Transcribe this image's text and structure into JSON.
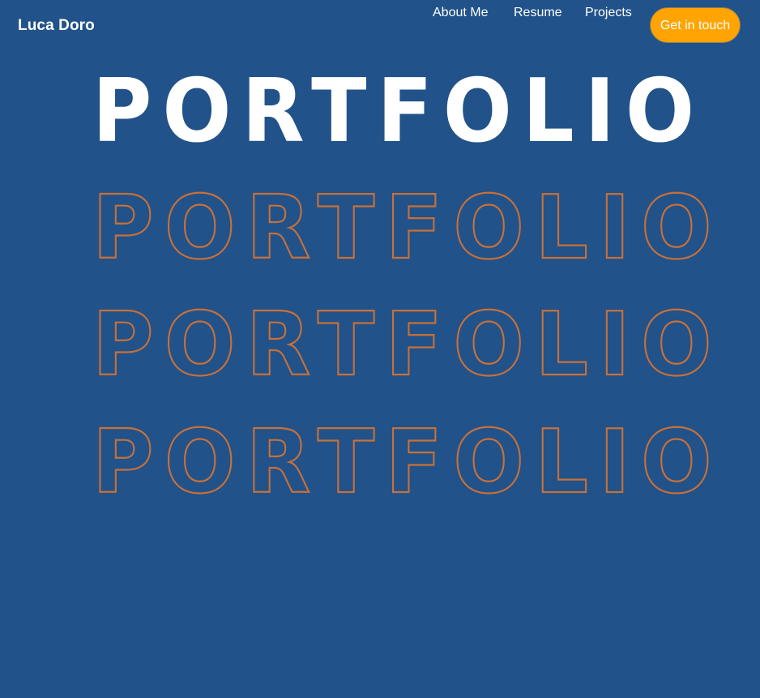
{
  "header": {
    "brand": "Luca Doro",
    "nav": [
      {
        "label": "About Me"
      },
      {
        "label": "Resume"
      },
      {
        "label": "Projects"
      }
    ],
    "cta_label": "Get in touch"
  },
  "hero": {
    "title_solid": "PORTFOLIO",
    "title_outline_1": "PORTFOLIO",
    "title_outline_2": "PORTFOLIO",
    "title_outline_3": "PORTFOLIO"
  },
  "colors": {
    "background": "#215289",
    "accent": "#ffa402",
    "outline_text": "#c7703a",
    "text": "#ffffff"
  }
}
